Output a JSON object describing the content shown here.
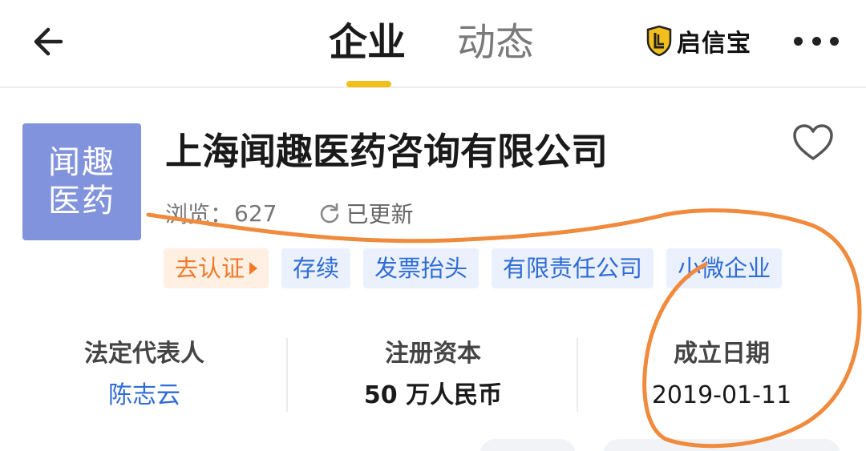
{
  "header": {
    "tabs": [
      {
        "label": "企业",
        "active": true
      },
      {
        "label": "动态",
        "active": false
      }
    ],
    "brand": "启信宝",
    "accent_color": "#f3bf1d"
  },
  "company": {
    "logo_lines": [
      "闻趣",
      "医药"
    ],
    "name": "上海闻趣医药咨询有限公司",
    "views_label": "浏览：",
    "views": "627",
    "updated": "已更新",
    "tags": [
      {
        "label": "去认证",
        "kind": "action"
      },
      {
        "label": "存续",
        "kind": "status"
      },
      {
        "label": "发票抬头",
        "kind": "status"
      },
      {
        "label": "有限责任公司",
        "kind": "status"
      },
      {
        "label": "小微企业",
        "kind": "status"
      }
    ]
  },
  "stats": [
    {
      "label": "法定代表人",
      "value": "陈志云"
    },
    {
      "label": "注册资本",
      "value": "50 万人民币"
    },
    {
      "label": "成立日期",
      "value": "2019-01-11"
    }
  ],
  "icons": {
    "back": "arrow-left-icon",
    "more": "more-dots-icon",
    "favorite": "heart-outline-icon",
    "refresh": "refresh-icon",
    "brand": "shield-logo-icon"
  },
  "annotation_color": "#f08a3c"
}
